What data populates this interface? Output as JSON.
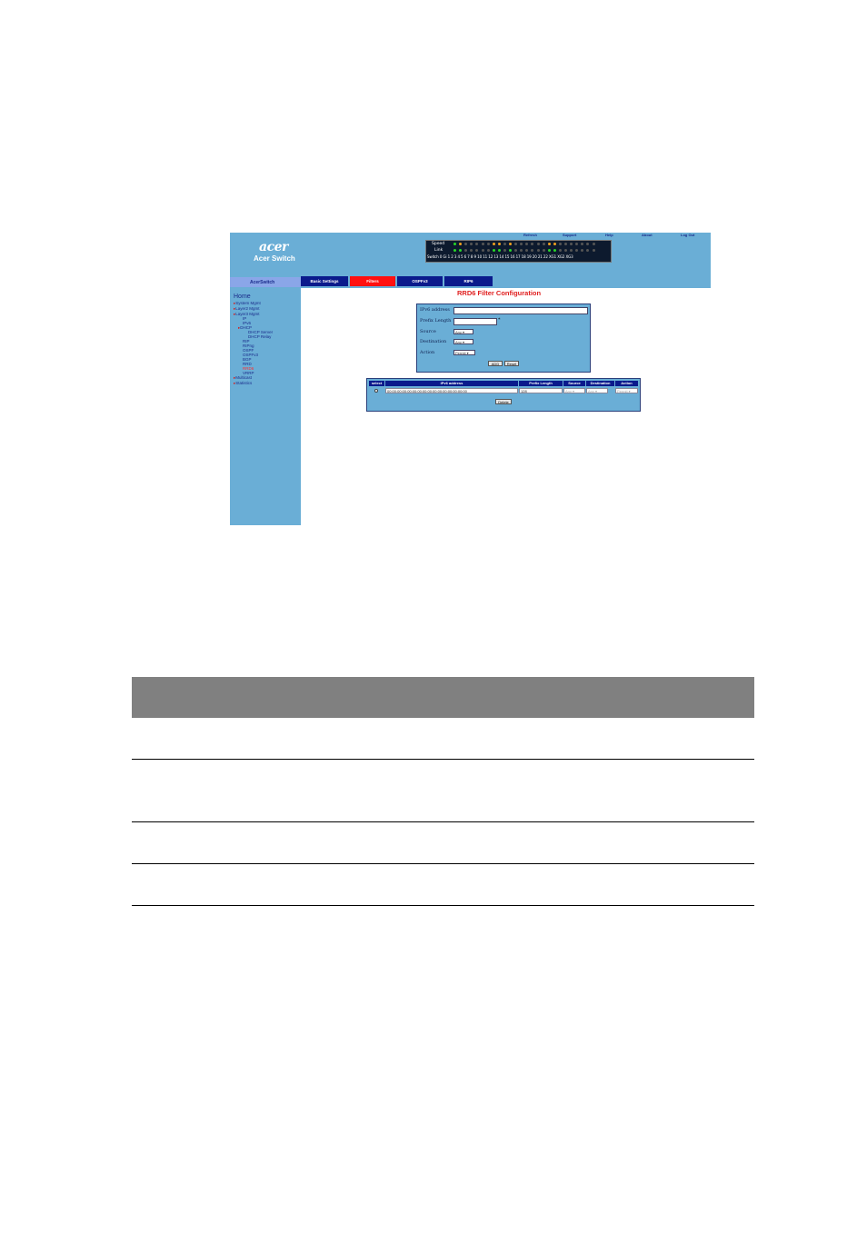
{
  "topbar": {
    "logo": "acer",
    "brand": "Acer Switch",
    "links": [
      "Refresh",
      "Support",
      "Help",
      "About",
      "Log Out"
    ]
  },
  "panel": {
    "speed_label": "Speed",
    "link_label": "Link",
    "port_row": "Switch 0 Gi 1  2  3  4  5  6  7  8  9 10 11 12 13 14 15 16 17 18 19 20 21 22 XG1 XG2 XG3",
    "colors": {
      "green": "#27d627",
      "amber": "#f0a020",
      "off": "#555555"
    }
  },
  "sidebar": {
    "header": "AcerSwitch",
    "home": "Home",
    "items": [
      {
        "label": "System Mgmt",
        "arrow": true
      },
      {
        "label": "Layer2 Mgmt",
        "arrow": true
      },
      {
        "label": "Layer3 Mgmt",
        "arrow": true
      },
      {
        "label": "IP"
      },
      {
        "label": "IPv6"
      },
      {
        "label": "DHCP",
        "arrow": true
      },
      {
        "label": "DHCP Server"
      },
      {
        "label": "DHCP Relay"
      },
      {
        "label": "RIP"
      },
      {
        "label": "RIPng"
      },
      {
        "label": "OSPF"
      },
      {
        "label": "OSPFv3"
      },
      {
        "label": "BGP"
      },
      {
        "label": "RRD"
      },
      {
        "label": "RRD6"
      },
      {
        "label": "VRRP"
      },
      {
        "label": "Multicast",
        "arrow": true
      },
      {
        "label": "Statistics",
        "arrow": true
      }
    ]
  },
  "tabs": [
    "Basic Settings",
    "Filters",
    "OSPFv3",
    "RIP6"
  ],
  "page_title": "RRD6 Filter Configuration",
  "form": {
    "ipv6_label": "IPv6 address",
    "prefix_label": "Prefix Length",
    "prefix_marker": "*",
    "source_label": "Source",
    "source_value": "Any",
    "destination_label": "Destination",
    "destination_value": "Any",
    "action_label": "Action",
    "action_value": "Permit",
    "add_label": "ADD",
    "reset_label": "Reset"
  },
  "table": {
    "headers": [
      "select",
      "IPv6 address",
      "Prefix Length",
      "Source",
      "Destination",
      "Action"
    ],
    "row": {
      "ipv6": "00:00:00:00:00:00:00:00:00:00:00:00:00:00:00:00",
      "prefix": "128",
      "source": "Any",
      "destination": "Any",
      "action": "Permit"
    },
    "delete_label": "Delete"
  },
  "accent": {
    "bg": "#6aaed6",
    "tab": "#0a1a8c",
    "active_tab": "#ff1010",
    "title": "#e02020"
  }
}
